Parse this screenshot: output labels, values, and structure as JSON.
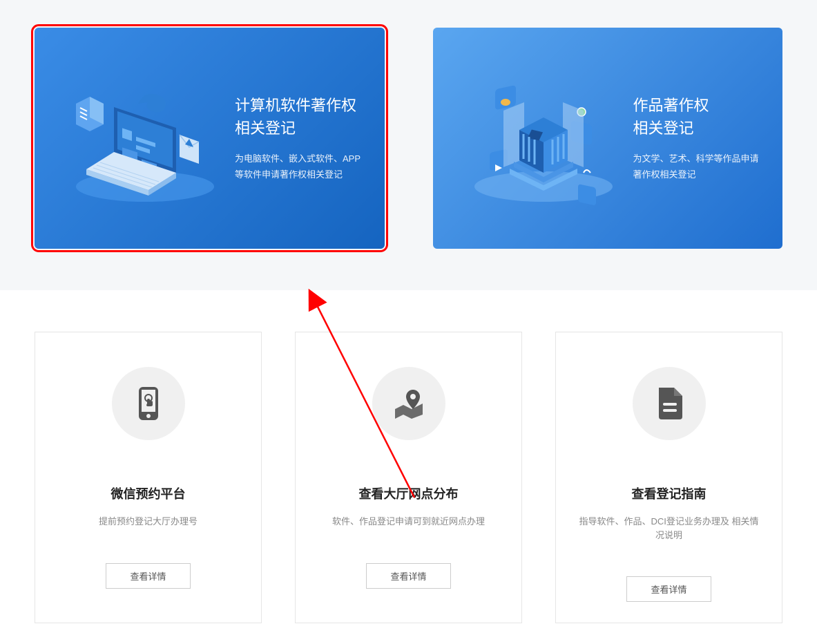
{
  "banners": [
    {
      "title_line1": "计算机软件著作权",
      "title_line2": "相关登记",
      "desc_line1": "为电脑软件、嵌入式软件、APP",
      "desc_line2": "等软件申请著作权相关登记"
    },
    {
      "title_line1": "作品著作权",
      "title_line2": "相关登记",
      "desc_line1": "为文学、艺术、科学等作品申请",
      "desc_line2": "著作权相关登记"
    }
  ],
  "info_cards": [
    {
      "title": "微信预约平台",
      "desc": "提前预约登记大厅办理号",
      "btn": "查看详情"
    },
    {
      "title": "查看大厅网点分布",
      "desc": "软件、作品登记申请可到就近网点办理",
      "btn": "查看详情"
    },
    {
      "title": "查看登记指南",
      "desc": "指导软件、作品、DCI登记业务办理及 相关情况说明",
      "btn": "查看详情"
    }
  ]
}
